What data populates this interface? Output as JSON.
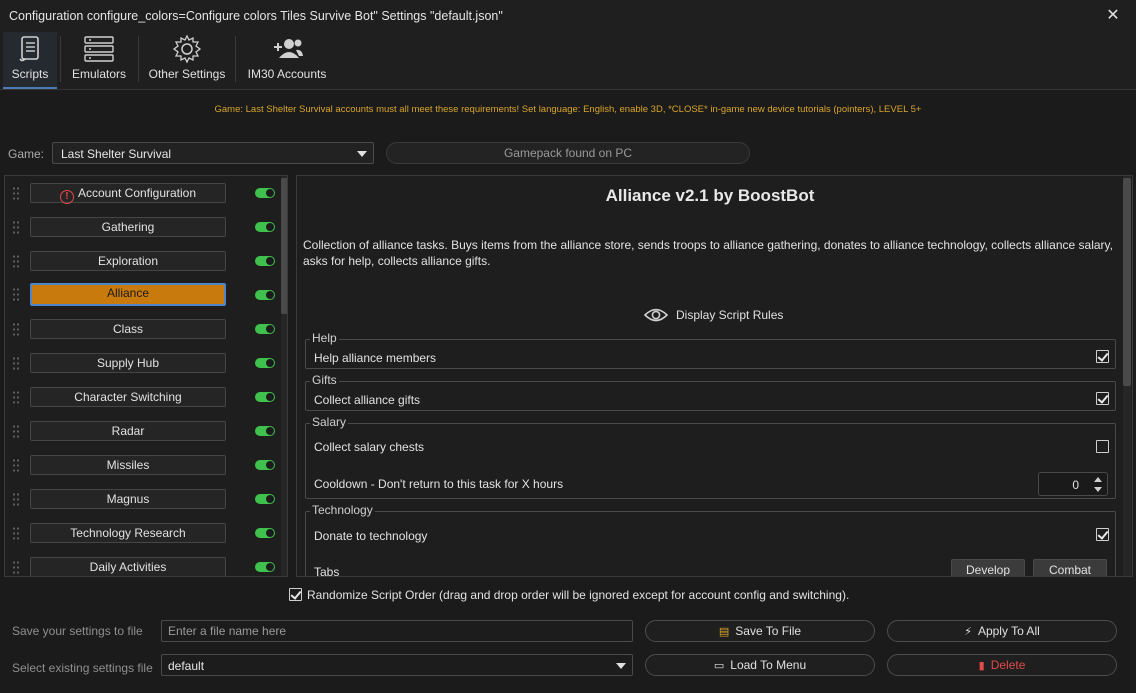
{
  "window": {
    "title": "Configuration configure_colors=Configure colors Tiles Survive Bot\" Settings \"default.json\"",
    "close_glyph": "✕"
  },
  "toolbar": {
    "items": [
      {
        "label": "Scripts",
        "icon": "scroll-icon",
        "active": true
      },
      {
        "label": "Emulators",
        "icon": "server-stack-icon",
        "active": false
      },
      {
        "label": "Other Settings",
        "icon": "gear-icon",
        "active": false
      },
      {
        "label": "IM30 Accounts",
        "icon": "users-icon",
        "active": false
      }
    ]
  },
  "requirements_notice": "Game: Last Shelter Survival accounts must all meet these requirements! Set language: English, enable 3D, *CLOSE* in-game new device tutorials (pointers), LEVEL 5+",
  "game": {
    "label": "Game:",
    "selected": "Last Shelter Survival",
    "status": "Gamepack found on PC"
  },
  "scripts": [
    {
      "label": "Account Configuration",
      "warning": true,
      "enabled": true,
      "active": false
    },
    {
      "label": "Gathering",
      "enabled": true,
      "active": false
    },
    {
      "label": "Exploration",
      "enabled": true,
      "active": false
    },
    {
      "label": "Alliance",
      "enabled": true,
      "active": true
    },
    {
      "label": "Class",
      "enabled": true,
      "active": false
    },
    {
      "label": "Supply Hub",
      "enabled": true,
      "active": false
    },
    {
      "label": "Character Switching",
      "enabled": true,
      "active": false
    },
    {
      "label": "Radar",
      "enabled": true,
      "active": false
    },
    {
      "label": "Missiles",
      "enabled": true,
      "active": false
    },
    {
      "label": "Magnus",
      "enabled": true,
      "active": false
    },
    {
      "label": "Technology Research",
      "enabled": true,
      "active": false
    },
    {
      "label": "Daily Activities",
      "enabled": true,
      "active": false
    }
  ],
  "script_detail": {
    "title": "Alliance v2.1 by BoostBot",
    "description": "Collection of alliance tasks. Buys items from the alliance store, sends troops to alliance gathering, donates to alliance technology, collects alliance salary, asks for help, collects alliance gifts.",
    "rules_button": "Display Script Rules",
    "groups": {
      "help": {
        "title": "Help",
        "option": "Help alliance members",
        "checked": true
      },
      "gifts": {
        "title": "Gifts",
        "option": "Collect alliance gifts",
        "checked": true
      },
      "salary": {
        "title": "Salary",
        "option": "Collect salary chests",
        "checked": false,
        "cooldown_label": "Cooldown - Don't return to this task for X hours",
        "cooldown_value": "0"
      },
      "technology": {
        "title": "Technology",
        "option": "Donate to technology",
        "checked": true,
        "tabs_label": "Tabs",
        "tabs": [
          "Develop",
          "Combat"
        ]
      }
    }
  },
  "randomize": {
    "label": "Randomize Script Order (drag and drop order will be ignored except for account config and switching).",
    "checked": true
  },
  "bottom": {
    "save_label": "Save your settings to file",
    "save_placeholder": "Enter a file name here",
    "select_label": "Select existing settings file",
    "select_value": "default",
    "save_button": "Save To File",
    "apply_button": "Apply To All",
    "load_button": "Load To Menu",
    "delete_button": "Delete"
  },
  "colors": {
    "accent": "#4e7ab5",
    "active_script": "#c97a0c",
    "toggle_on": "#3ec24d",
    "notice": "#d9a52b",
    "danger": "#e34a4a"
  }
}
